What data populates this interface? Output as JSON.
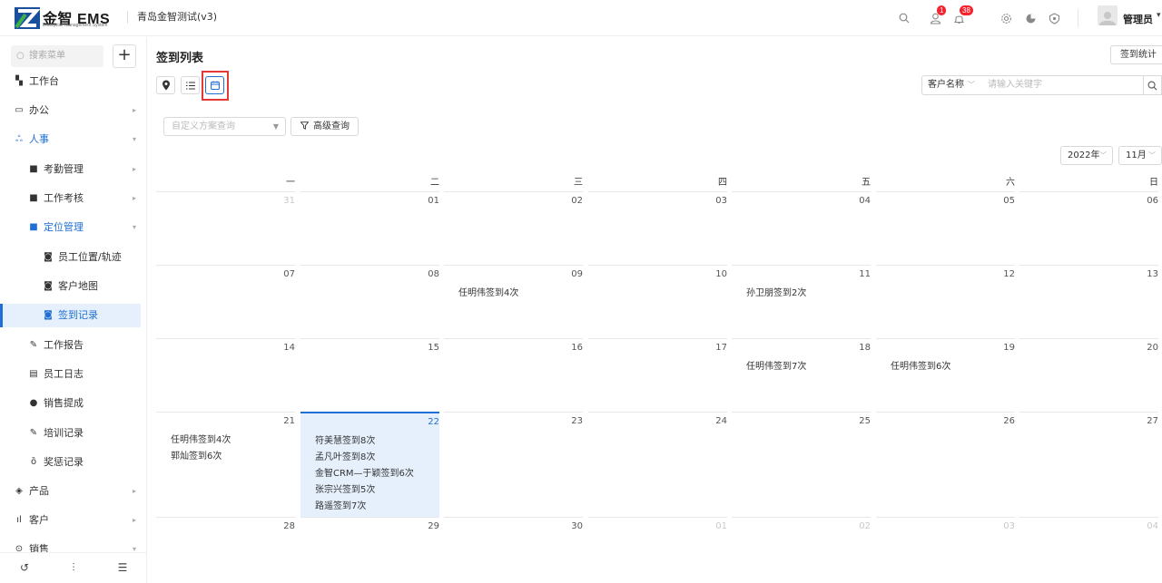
{
  "header": {
    "logo_text": "金智 EMS",
    "logo_sub": "Enterprise Management System",
    "company": "青岛金智测试(v3)",
    "badges": {
      "contacts": "1",
      "notifications": "38"
    },
    "user_name": "管理员"
  },
  "sidebar": {
    "search_placeholder": "搜索菜单",
    "add_label": "+",
    "items": [
      {
        "label": "工作台",
        "icon": "dashboard-icon"
      },
      {
        "label": "办公",
        "icon": "monitor-icon"
      },
      {
        "label": "人事",
        "icon": "people-icon"
      },
      {
        "label": "考勤管理",
        "icon": "folder-icon"
      },
      {
        "label": "工作考核",
        "icon": "folder-icon"
      },
      {
        "label": "定位管理",
        "icon": "folder-open-icon"
      },
      {
        "label": "员工位置/轨迹",
        "icon": "map-icon"
      },
      {
        "label": "客户地图",
        "icon": "map-icon"
      },
      {
        "label": "签到记录",
        "icon": "map-icon"
      },
      {
        "label": "工作报告",
        "icon": "report-icon"
      },
      {
        "label": "员工日志",
        "icon": "log-icon"
      },
      {
        "label": "销售提成",
        "icon": "coin-icon"
      },
      {
        "label": "培训记录",
        "icon": "training-icon"
      },
      {
        "label": "奖惩记录",
        "icon": "medal-icon"
      },
      {
        "label": "产品",
        "icon": "cube-icon"
      },
      {
        "label": "客户",
        "icon": "chart-icon"
      },
      {
        "label": "销售",
        "icon": "sales-icon"
      }
    ]
  },
  "main": {
    "title": "签到列表",
    "stats_button": "签到统计",
    "filter_field": "客户名称",
    "keyword_placeholder": "请输入关键字",
    "scheme_placeholder": "自定义方案查询",
    "advanced_query": "高级查询",
    "year": "2022年",
    "month": "11月"
  },
  "calendar": {
    "weekdays": [
      "一",
      "二",
      "三",
      "四",
      "五",
      "六",
      "日"
    ],
    "weeks": [
      [
        {
          "d": "31",
          "o": true,
          "ev": []
        },
        {
          "d": "01",
          "ev": []
        },
        {
          "d": "02",
          "ev": []
        },
        {
          "d": "03",
          "ev": []
        },
        {
          "d": "04",
          "ev": []
        },
        {
          "d": "05",
          "ev": []
        },
        {
          "d": "06",
          "ev": []
        }
      ],
      [
        {
          "d": "07",
          "ev": []
        },
        {
          "d": "08",
          "ev": []
        },
        {
          "d": "09",
          "ev": [
            "任明伟签到4次"
          ]
        },
        {
          "d": "10",
          "ev": []
        },
        {
          "d": "11",
          "ev": [
            "孙卫朋签到2次"
          ]
        },
        {
          "d": "12",
          "ev": []
        },
        {
          "d": "13",
          "ev": []
        }
      ],
      [
        {
          "d": "14",
          "ev": []
        },
        {
          "d": "15",
          "ev": []
        },
        {
          "d": "16",
          "ev": []
        },
        {
          "d": "17",
          "ev": []
        },
        {
          "d": "18",
          "ev": [
            "任明伟签到7次"
          ]
        },
        {
          "d": "19",
          "ev": [
            "任明伟签到6次"
          ]
        },
        {
          "d": "20",
          "ev": []
        }
      ],
      [
        {
          "d": "21",
          "ev": [
            "任明伟签到4次",
            "郭灿签到6次"
          ]
        },
        {
          "d": "22",
          "today": true,
          "ev": [
            "符美慧签到8次",
            "孟凡叶签到8次",
            "金智CRM—于颖签到6次",
            "张宗兴签到5次",
            "路遥签到7次"
          ]
        },
        {
          "d": "23",
          "ev": []
        },
        {
          "d": "24",
          "ev": []
        },
        {
          "d": "25",
          "ev": []
        },
        {
          "d": "26",
          "ev": []
        },
        {
          "d": "27",
          "ev": []
        }
      ],
      [
        {
          "d": "28",
          "ev": []
        },
        {
          "d": "29",
          "ev": []
        },
        {
          "d": "30",
          "ev": []
        },
        {
          "d": "01",
          "o": true,
          "ev": []
        },
        {
          "d": "02",
          "o": true,
          "ev": []
        },
        {
          "d": "03",
          "o": true,
          "ev": []
        },
        {
          "d": "04",
          "o": true,
          "ev": []
        }
      ]
    ]
  }
}
